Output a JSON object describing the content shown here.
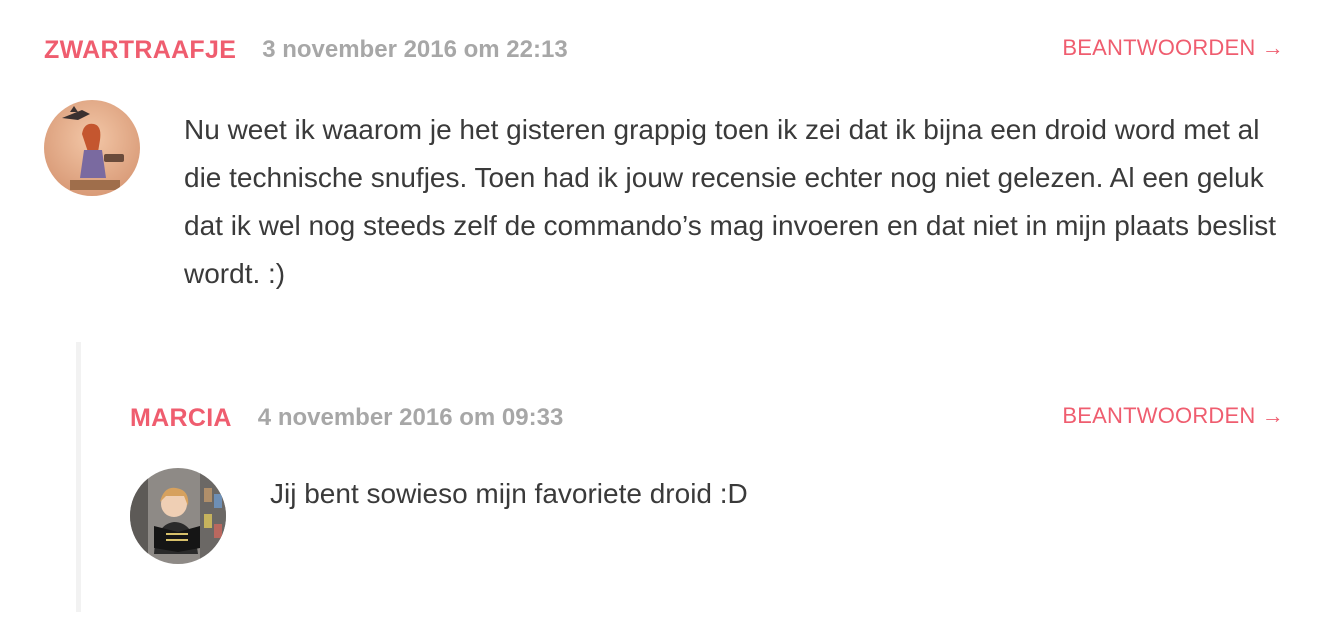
{
  "comments": [
    {
      "author": "ZWARTRAAFJE",
      "date": "3 november 2016 om 22:13",
      "reply_label": "BEANTWOORDEN →",
      "avatar_icon": "avatar-illustration-icon",
      "text": "Nu weet ik waarom je het gisteren grappig toen ik zei dat ik bijna een droid word met al die technische snufjes. Toen had ik jouw recensie echter nog niet gelezen. Al een geluk dat ik wel nog steeds zelf de commando’s mag invoeren en dat niet in mijn plaats beslist wordt. :)"
    },
    {
      "author": "MARCIA",
      "date": "4 november 2016 om 09:33",
      "reply_label": "BEANTWOORDEN →",
      "avatar_icon": "avatar-photo-icon",
      "text": "Jij bent sowieso mijn favoriete droid :D"
    }
  ],
  "colors": {
    "accent": "#ef5d6f",
    "meta": "#a7a7a7",
    "text": "#3a3a3a",
    "thread_line": "#f2f2f2"
  }
}
